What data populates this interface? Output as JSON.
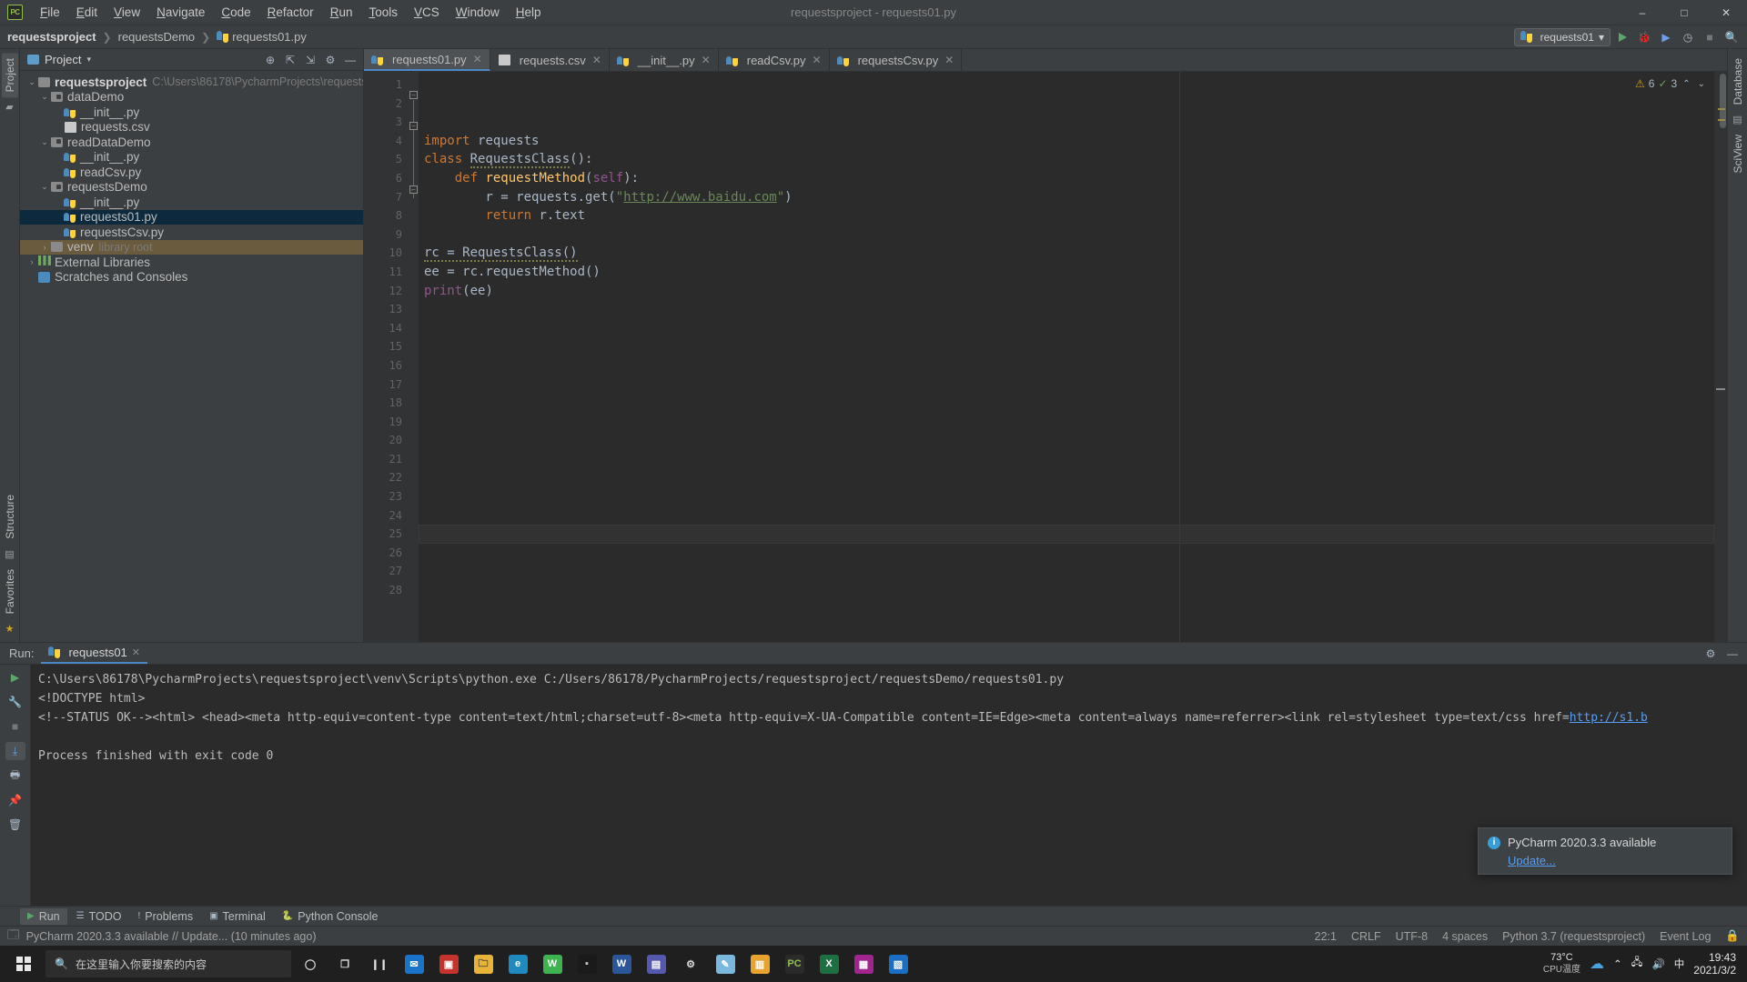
{
  "window": {
    "title": "requestsproject - requests01.py",
    "minimize": "–",
    "maximize": "□",
    "close": "✕"
  },
  "menu": {
    "logo": "PC",
    "items": [
      "File",
      "Edit",
      "View",
      "Navigate",
      "Code",
      "Refactor",
      "Run",
      "Tools",
      "VCS",
      "Window",
      "Help"
    ]
  },
  "breadcrumb": {
    "project": "requestsproject",
    "folder": "requestsDemo",
    "file": "requests01.py",
    "separator": "❯"
  },
  "toolbar": {
    "run_config": "requests01",
    "dropdown_caret": "▾",
    "run_icon": "run-icon",
    "debug_icon": "🐞",
    "coverage_icon": "▶",
    "profile_icon": "◷",
    "stop_icon": "■",
    "search_icon": "🔍"
  },
  "left_strip": {
    "project_tab": "Project",
    "structure_tab": "Structure",
    "favorites_tab": "Favorites"
  },
  "right_strip": {
    "database_tab": "Database",
    "sciview_tab": "SciView"
  },
  "project_pane": {
    "title": "Project",
    "caret": "▾",
    "icons": [
      "locate-icon",
      "collapse-all-icon",
      "expand-icon",
      "settings-icon",
      "hide-icon"
    ],
    "tree": [
      {
        "label": "requestsproject",
        "detail": "C:\\Users\\86178\\PycharmProjects\\requestsproject",
        "depth": 0,
        "arrow": "expanded",
        "icon": "folder",
        "bold": true,
        "state": "normal"
      },
      {
        "label": "dataDemo",
        "detail": "",
        "depth": 1,
        "arrow": "expanded",
        "icon": "source-folder",
        "bold": false,
        "state": "normal"
      },
      {
        "label": "__init__.py",
        "detail": "",
        "depth": 2,
        "arrow": "none",
        "icon": "python",
        "bold": false,
        "state": "normal"
      },
      {
        "label": "requests.csv",
        "detail": "",
        "depth": 2,
        "arrow": "none",
        "icon": "csv",
        "bold": false,
        "state": "normal"
      },
      {
        "label": "readDataDemo",
        "detail": "",
        "depth": 1,
        "arrow": "expanded",
        "icon": "source-folder",
        "bold": false,
        "state": "normal"
      },
      {
        "label": "__init__.py",
        "detail": "",
        "depth": 2,
        "arrow": "none",
        "icon": "python",
        "bold": false,
        "state": "normal"
      },
      {
        "label": "readCsv.py",
        "detail": "",
        "depth": 2,
        "arrow": "none",
        "icon": "python",
        "bold": false,
        "state": "normal"
      },
      {
        "label": "requestsDemo",
        "detail": "",
        "depth": 1,
        "arrow": "expanded",
        "icon": "source-folder",
        "bold": false,
        "state": "normal"
      },
      {
        "label": "__init__.py",
        "detail": "",
        "depth": 2,
        "arrow": "none",
        "icon": "python",
        "bold": false,
        "state": "normal"
      },
      {
        "label": "requests01.py",
        "detail": "",
        "depth": 2,
        "arrow": "none",
        "icon": "python",
        "bold": false,
        "state": "selected"
      },
      {
        "label": "requestsCsv.py",
        "detail": "",
        "depth": 2,
        "arrow": "none",
        "icon": "python",
        "bold": false,
        "state": "normal"
      },
      {
        "label": "venv",
        "detail": "library root",
        "depth": 1,
        "arrow": "collapsed",
        "icon": "folder",
        "bold": false,
        "state": "highlight"
      },
      {
        "label": "External Libraries",
        "detail": "",
        "depth": 0,
        "arrow": "collapsed",
        "icon": "library",
        "bold": false,
        "state": "normal"
      },
      {
        "label": "Scratches and Consoles",
        "detail": "",
        "depth": 0,
        "arrow": "none",
        "icon": "scratch",
        "bold": false,
        "state": "normal"
      }
    ]
  },
  "editor": {
    "tabs": [
      {
        "label": "requests01.py",
        "icon": "python",
        "active": true
      },
      {
        "label": "requests.csv",
        "icon": "csv",
        "active": false
      },
      {
        "label": "__init__.py",
        "icon": "python",
        "active": false
      },
      {
        "label": "readCsv.py",
        "icon": "python",
        "active": false
      },
      {
        "label": "requestsCsv.py",
        "icon": "python",
        "active": false
      }
    ],
    "tab_close": "✕",
    "line_numbers": [
      1,
      2,
      3,
      4,
      5,
      6,
      7,
      8,
      9,
      10,
      11,
      12,
      13,
      14,
      15,
      16,
      17,
      18,
      19,
      20,
      21,
      22,
      23,
      24,
      25,
      26,
      27,
      28
    ],
    "caret_line": 22,
    "code_lines": [
      {
        "n": 1,
        "tokens": [
          {
            "t": "import ",
            "c": "kw"
          },
          {
            "t": "requests",
            "c": "pln"
          }
        ]
      },
      {
        "n": 2,
        "tokens": [
          {
            "t": "class ",
            "c": "kw"
          },
          {
            "t": "RequestsClass",
            "c": "warn"
          },
          {
            "t": "():",
            "c": "pln"
          }
        ]
      },
      {
        "n": 3,
        "tokens": [
          {
            "t": "    ",
            "c": "pln"
          },
          {
            "t": "def ",
            "c": "kw"
          },
          {
            "t": "requestMethod",
            "c": "fn"
          },
          {
            "t": "(",
            "c": "pln"
          },
          {
            "t": "self",
            "c": "self"
          },
          {
            "t": "):",
            "c": "pln"
          }
        ]
      },
      {
        "n": 4,
        "tokens": [
          {
            "t": "        r = requests.get(",
            "c": "pln"
          },
          {
            "t": "\"",
            "c": "str"
          },
          {
            "t": "http://www.baidu.com",
            "c": "link"
          },
          {
            "t": "\"",
            "c": "str"
          },
          {
            "t": ")",
            "c": "pln"
          }
        ]
      },
      {
        "n": 5,
        "tokens": [
          {
            "t": "        ",
            "c": "pln"
          },
          {
            "t": "return ",
            "c": "kw"
          },
          {
            "t": "r.text",
            "c": "pln"
          }
        ]
      },
      {
        "n": 6,
        "tokens": []
      },
      {
        "n": 7,
        "tokens": [
          {
            "t": "rc = RequestsClass()",
            "c": "warn"
          }
        ]
      },
      {
        "n": 8,
        "tokens": [
          {
            "t": "ee = rc.requestMethod()",
            "c": "pln"
          }
        ]
      },
      {
        "n": 9,
        "tokens": [
          {
            "t": "print",
            "c": "fnbuilt"
          },
          {
            "t": "(ee)",
            "c": "pln"
          }
        ]
      }
    ],
    "inspection": {
      "warning_icon": "⚠",
      "warning_count": "6",
      "ok_icon": "✓",
      "ok_count": "3",
      "up_chevron": "⌃",
      "down_chevron": "⌄"
    }
  },
  "run_pane": {
    "label": "Run:",
    "tab_name": "requests01",
    "tab_close": "✕",
    "settings_icon": "⚙",
    "hide_icon": "—",
    "toolbar_icons": [
      "rerun-icon",
      "stop-icon",
      "wrench-icon",
      "print-icon",
      "scroll-end-icon",
      "trash-icon"
    ],
    "console_lines": [
      {
        "text": "C:\\Users\\86178\\PycharmProjects\\requestsproject\\venv\\Scripts\\python.exe C:/Users/86178/PycharmProjects/requestsproject/requestsDemo/requests01.py",
        "link": ""
      },
      {
        "text": "<!DOCTYPE html>",
        "link": ""
      },
      {
        "text": "<!--STATUS OK--><html> <head><meta http-equiv=content-type content=text/html;charset=utf-8><meta http-equiv=X-UA-Compatible content=IE=Edge><meta content=always name=referrer><link rel=stylesheet type=text/css href=",
        "link": "http://s1.b"
      },
      {
        "text": "",
        "link": ""
      },
      {
        "text": "Process finished with exit code 0",
        "link": ""
      }
    ]
  },
  "bottom_tabs": [
    {
      "label": "Run",
      "icon": "run-icon",
      "active": true
    },
    {
      "label": "TODO",
      "icon": "todo-icon",
      "active": false
    },
    {
      "label": "Problems",
      "icon": "problems-icon",
      "active": false
    },
    {
      "label": "Terminal",
      "icon": "terminal-icon",
      "active": false
    },
    {
      "label": "Python Console",
      "icon": "python-icon",
      "active": false
    }
  ],
  "statusbar": {
    "message": "PyCharm 2020.3.3 available // Update... (10 minutes ago)",
    "caret_position": "22:1",
    "line_separator": "CRLF",
    "encoding": "UTF-8",
    "indent": "4 spaces",
    "interpreter": "Python 3.7 (requestsproject)",
    "event_log": "Event Log",
    "lock_icon": "🔒"
  },
  "notification": {
    "title": "PyCharm 2020.3.3 available",
    "link": "Update...",
    "info_icon": "i"
  },
  "taskbar": {
    "search_placeholder": "在这里输入你要搜索的内容",
    "search_icon": "🔍",
    "apps": [
      {
        "name": "cortana-icon",
        "glyph": "◯",
        "color": "transparent",
        "text": "#e0e0e0"
      },
      {
        "name": "task-view-icon",
        "glyph": "❐",
        "color": "transparent",
        "text": "#e0e0e0"
      },
      {
        "name": "media-icon",
        "glyph": "❙❙",
        "color": "transparent",
        "text": "#e0e0e0"
      },
      {
        "name": "mail-icon",
        "glyph": "✉",
        "color": "#1a73c8",
        "text": "#ffffff"
      },
      {
        "name": "app-red-icon",
        "glyph": "▣",
        "color": "#c5342c",
        "text": "#ffffff"
      },
      {
        "name": "explorer-icon",
        "glyph": "🗀",
        "color": "#e8b339",
        "text": "#3a3a3a"
      },
      {
        "name": "edge-icon",
        "glyph": "e",
        "color": "#1f8ac0",
        "text": "#ffffff"
      },
      {
        "name": "wechat-icon",
        "glyph": "W",
        "color": "#3eb34f",
        "text": "#ffffff"
      },
      {
        "name": "terminal-icon",
        "glyph": "▪",
        "color": "#1a1a1a",
        "text": "#cccccc"
      },
      {
        "name": "word-icon",
        "glyph": "W",
        "color": "#2b579a",
        "text": "#ffffff"
      },
      {
        "name": "teams-icon",
        "glyph": "▤",
        "color": "#5558af",
        "text": "#ffffff"
      },
      {
        "name": "settings-icon",
        "glyph": "⚙",
        "color": "transparent",
        "text": "#d8d8d8"
      },
      {
        "name": "paint-icon",
        "glyph": "✎",
        "color": "#7ab8dd",
        "text": "#ffffff"
      },
      {
        "name": "note-icon",
        "glyph": "▥",
        "color": "#e6a32e",
        "text": "#ffffff"
      },
      {
        "name": "pycharm-icon",
        "glyph": "PC",
        "color": "#2b2b2b",
        "text": "#8fbf4f"
      },
      {
        "name": "excel-icon",
        "glyph": "X",
        "color": "#1d6f42",
        "text": "#ffffff"
      },
      {
        "name": "chart-icon",
        "glyph": "▦",
        "color": "#a2258f",
        "text": "#ffffff"
      },
      {
        "name": "blue-app-icon",
        "glyph": "▧",
        "color": "#1a6fc4",
        "text": "#ffffff"
      }
    ],
    "tray": {
      "temperature": "73°C",
      "temp_label": "CPU温度",
      "weather_icon": "☁",
      "chevron_icon": "⌃",
      "network_icon": "🖧",
      "volume_icon": "🔊",
      "ime_icon": "中",
      "time": "19:43",
      "date": "2021/3/2"
    }
  }
}
